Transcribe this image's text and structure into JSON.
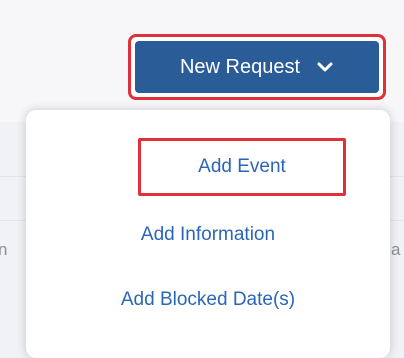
{
  "toolbar": {
    "new_request_label": "New Request",
    "dropdown_icon": "chevron-down-icon"
  },
  "menu": {
    "items": [
      {
        "label": "Add Event",
        "highlighted": true
      },
      {
        "label": "Add Information",
        "highlighted": false
      },
      {
        "label": "Add Blocked Date(s)",
        "highlighted": false
      }
    ]
  },
  "background": {
    "left_fragment": "n",
    "right_fragment": "a"
  },
  "colors": {
    "button_bg": "#2a5c97",
    "link_text": "#2a66b8",
    "highlight_border": "#e0313a"
  }
}
